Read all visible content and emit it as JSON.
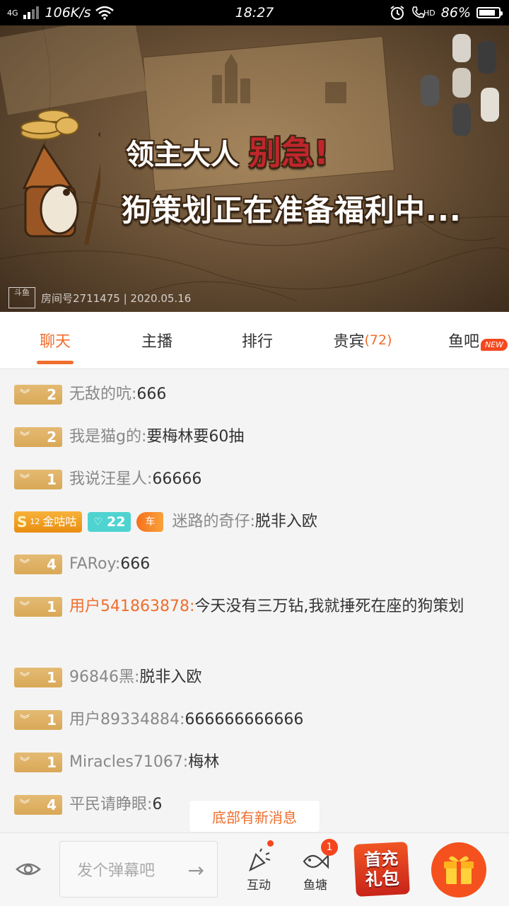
{
  "status_bar": {
    "network": "4G",
    "speed": "106K/s",
    "time": "18:27",
    "hd": "HD",
    "battery": "86%",
    "battery_level": 0.86
  },
  "banner": {
    "line1_a": "领主大人",
    "line1_b": "别急!",
    "line2": "狗策划正在准备福利中...",
    "logo_text": "斗鱼",
    "room_info": "房间号2711475 | 2020.05.16"
  },
  "tabs": [
    {
      "label": "聊天",
      "count": ""
    },
    {
      "label": "主播",
      "count": ""
    },
    {
      "label": "排行",
      "count": ""
    },
    {
      "label": "贵宾",
      "count": "(72)"
    },
    {
      "label": "鱼吧",
      "count": "",
      "badge": "NEW"
    }
  ],
  "chat": {
    "messages": [
      {
        "level": "2",
        "user": "无敌的吭:",
        "text": "666"
      },
      {
        "level": "2",
        "user": "我是猫g的:",
        "text": "要梅林要60抽"
      },
      {
        "level": "1",
        "user": "我说汪星人:",
        "text": "66666"
      },
      {
        "level": "",
        "noble": "金咕咕",
        "noble_num": "12",
        "fan_level": "22",
        "car": "车",
        "user": "迷路的奇仔:",
        "text": "脱非入欧"
      },
      {
        "level": "4",
        "user": "FARoy:",
        "text": "666"
      },
      {
        "level": "1",
        "user": "用户541863878:",
        "text": "今天没有三万钻,我就捶死在座的狗策划"
      },
      {
        "level": "1",
        "user": "96846黑:",
        "text": "脱非入欧"
      },
      {
        "level": "1",
        "user": "用户89334884:",
        "text": "666666666666"
      },
      {
        "level": "1",
        "user": "Miracles71067:",
        "text": "梅林"
      },
      {
        "level": "4",
        "user": "平民请睁眼:",
        "text": "6"
      }
    ],
    "new_message_tip": "底部有新消息"
  },
  "bottom": {
    "input_placeholder": "发个弹幕吧",
    "interact_label": "互动",
    "fishpond_label": "鱼塘",
    "fishpond_count": "1",
    "first_pack_line1": "首充",
    "first_pack_line2": "礼包"
  },
  "colors": {
    "accent": "#f06e2d",
    "level_badge": "#dcac5e",
    "fan_badge": "#4fd3d0",
    "gift": "#f4511e"
  }
}
